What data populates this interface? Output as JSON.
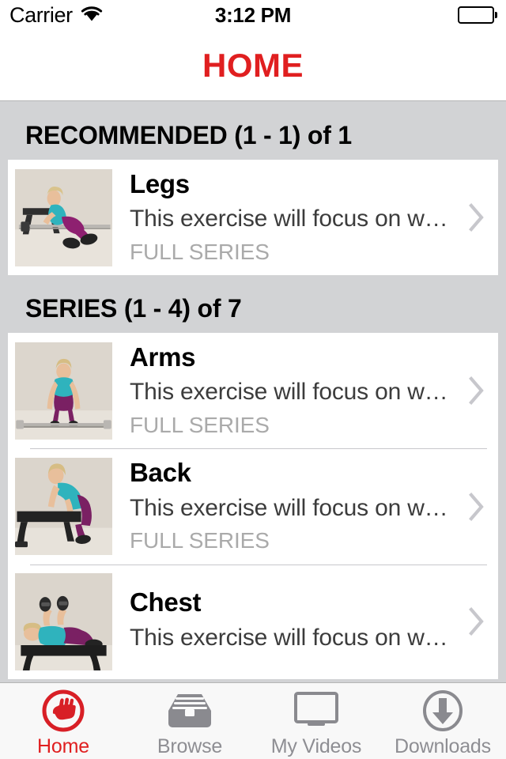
{
  "status_bar": {
    "carrier": "Carrier",
    "wifi_icon": "wifi-icon",
    "time": "3:12 PM",
    "battery_icon": "battery-full-icon"
  },
  "nav_bar": {
    "title": "HOME",
    "title_color": "#e01f20"
  },
  "theme": {
    "accent": "#e01f20",
    "table_background": "#d2d3d5",
    "cell_background": "#ffffff",
    "separator": "#c8c7cc",
    "subtitle_color": "#3c3c3c",
    "meta_color": "#aaaaaa",
    "tab_inactive": "#8e8e93"
  },
  "sections": [
    {
      "header": "RECOMMENDED (1 - 1) of 1",
      "name": "recommended",
      "rows": [
        {
          "title": "Legs",
          "description": "This exercise will focus on w…",
          "meta": "FULL SERIES",
          "thumbnail": "legs-thumbnail",
          "accessory_icon": "chevron-right-icon"
        }
      ]
    },
    {
      "header": "SERIES (1 - 4) of 7",
      "name": "series",
      "rows": [
        {
          "title": "Arms",
          "description": "This exercise will focus on w…",
          "meta": "FULL SERIES",
          "thumbnail": "arms-thumbnail",
          "accessory_icon": "chevron-right-icon"
        },
        {
          "title": "Back",
          "description": "This exercise will focus on w…",
          "meta": "FULL SERIES",
          "thumbnail": "back-thumbnail",
          "accessory_icon": "chevron-right-icon"
        },
        {
          "title": "Chest",
          "description": "This exercise will focus on w…",
          "meta": "",
          "thumbnail": "chest-thumbnail",
          "accessory_icon": "chevron-right-icon"
        }
      ]
    }
  ],
  "tab_bar": {
    "tabs": [
      {
        "label": "Home",
        "icon": "fist-circle-icon",
        "active": true
      },
      {
        "label": "Browse",
        "icon": "inbox-tray-icon",
        "active": false
      },
      {
        "label": "My Videos",
        "icon": "monitor-icon",
        "active": false
      },
      {
        "label": "Downloads",
        "icon": "download-circle-icon",
        "active": false
      }
    ]
  }
}
